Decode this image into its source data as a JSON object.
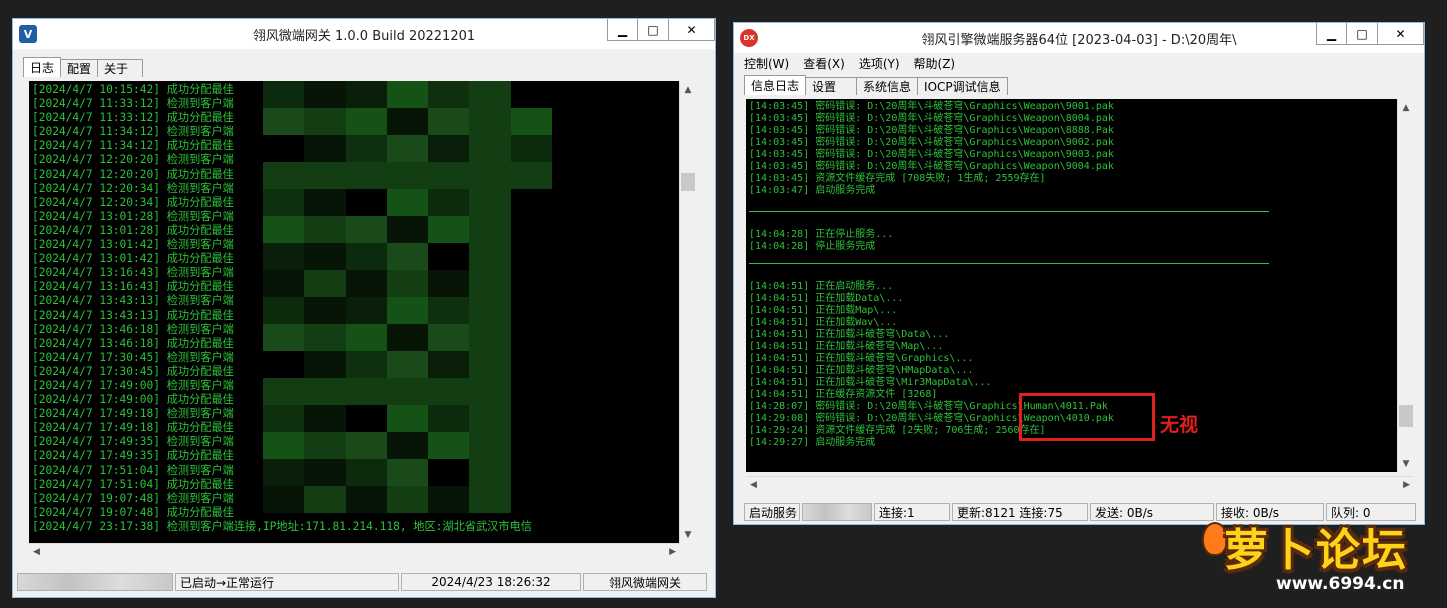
{
  "left_window": {
    "title": "翎风微端网关 1.0.0 Build 20221201",
    "tabs": [
      "日志",
      "配置",
      "关于"
    ],
    "log_lines": [
      "[2024/4/7 10:15:42] 成功分配最佳",
      "[2024/4/7 11:33:12] 检测到客户端",
      "[2024/4/7 11:33:12] 成功分配最佳",
      "[2024/4/7 11:34:12] 检测到客户端",
      "[2024/4/7 11:34:12] 成功分配最佳",
      "[2024/4/7 12:20:20] 检测到客户端",
      "[2024/4/7 12:20:20] 成功分配最佳",
      "[2024/4/7 12:20:34] 检测到客户端",
      "[2024/4/7 12:20:34] 成功分配最佳",
      "[2024/4/7 13:01:28] 检测到客户端",
      "[2024/4/7 13:01:28] 成功分配最佳",
      "[2024/4/7 13:01:42] 检测到客户端",
      "[2024/4/7 13:01:42] 成功分配最佳",
      "[2024/4/7 13:16:43] 检测到客户端",
      "[2024/4/7 13:16:43] 成功分配最佳",
      "[2024/4/7 13:43:13] 检测到客户端",
      "[2024/4/7 13:43:13] 成功分配最佳",
      "[2024/4/7 13:46:18] 检测到客户端",
      "[2024/4/7 13:46:18] 成功分配最佳",
      "[2024/4/7 17:30:45] 检测到客户端",
      "[2024/4/7 17:30:45] 成功分配最佳",
      "[2024/4/7 17:49:00] 检测到客户端",
      "[2024/4/7 17:49:00] 成功分配最佳",
      "[2024/4/7 17:49:18] 检测到客户端",
      "[2024/4/7 17:49:18] 成功分配最佳",
      "[2024/4/7 17:49:35] 检测到客户端",
      "[2024/4/7 17:49:35] 成功分配最佳",
      "[2024/4/7 17:51:04] 检测到客户端",
      "[2024/4/7 17:51:04] 成功分配最佳",
      "[2024/4/7 19:07:48] 检测到客户端",
      "[2024/4/7 19:07:48] 成功分配最佳",
      "[2024/4/7 23:17:38] 检测到客户端连接,IP地址:171.81.214.118, 地区:湖北省武汉市电信"
    ],
    "status": {
      "state": "已启动→正常运行",
      "datetime": "2024/4/23 18:26:32",
      "app_name": "翎风微端网关"
    }
  },
  "right_window": {
    "title": "翎风引擎微端服务器64位 [2023-04-03] - D:\\20周年\\",
    "menu": [
      "控制(W)",
      "查看(X)",
      "选项(Y)",
      "帮助(Z)"
    ],
    "tabs": [
      "信息日志",
      "设置",
      "系统信息",
      "IOCP调试信息"
    ],
    "log_block1": [
      "[14:03:45] 密码错误: D:\\20周年\\斗破苍穹\\Graphics\\Weapon\\9001.pak",
      "[14:03:45] 密码错误: D:\\20周年\\斗破苍穹\\Graphics\\Weapon\\8004.pak",
      "[14:03:45] 密码错误: D:\\20周年\\斗破苍穹\\Graphics\\Weapon\\8888.Pak",
      "[14:03:45] 密码错误: D:\\20周年\\斗破苍穹\\Graphics\\Weapon\\9002.pak",
      "[14:03:45] 密码错误: D:\\20周年\\斗破苍穹\\Graphics\\Weapon\\9003.pak",
      "[14:03:45] 密码错误: D:\\20周年\\斗破苍穹\\Graphics\\Weapon\\9004.pak",
      "[14:03:45] 资源文件缓存完成 [708失败; 1生成; 2559存在]",
      "[14:03:47] 启动服务完成"
    ],
    "log_block2": [
      "[14:04:28] 正在停止服务...",
      "[14:04:28] 停止服务完成"
    ],
    "log_block3": [
      "[14:04:51] 正在启动服务...",
      "[14:04:51] 正在加载Data\\...",
      "[14:04:51] 正在加载Map\\...",
      "[14:04:51] 正在加载Wav\\...",
      "[14:04:51] 正在加载斗破苍穹\\Data\\...",
      "[14:04:51] 正在加载斗破苍穹\\Map\\...",
      "[14:04:51] 正在加载斗破苍穹\\Graphics\\...",
      "[14:04:51] 正在加载斗破苍穹\\HMapData\\...",
      "[14:04:51] 正在加载斗破苍穹\\Mir3MapData\\...",
      "[14:04:51] 正在缓存资源文件 [3268]",
      "[14:28:07] 密码错误: D:\\20周年\\斗破苍穹\\Graphics\\Human\\4011.Pak",
      "[14:29:08] 密码错误: D:\\20周年\\斗破苍穹\\Graphics\\Weapon\\4010.pak",
      "[14:29:24] 资源文件缓存完成 [2失败; 706生成; 2560存在]",
      "[14:29:27] 启动服务完成"
    ],
    "status": {
      "start_button": "启动服务",
      "connections": "连接:1",
      "updates": "更新:8121",
      "connections2": "连接:75",
      "send": "发送: 0B/s",
      "receive": "接收: 0B/s",
      "queue": "队列: 0"
    }
  },
  "annotation": {
    "label": "无视",
    "color": "#e0201c"
  },
  "watermark": {
    "brand": "萝卜论坛",
    "url": "www.6994.cn"
  },
  "colors": {
    "console_bg": "#000000",
    "console_text": "#2dc23a",
    "window_bg": "#f0f0f0"
  }
}
